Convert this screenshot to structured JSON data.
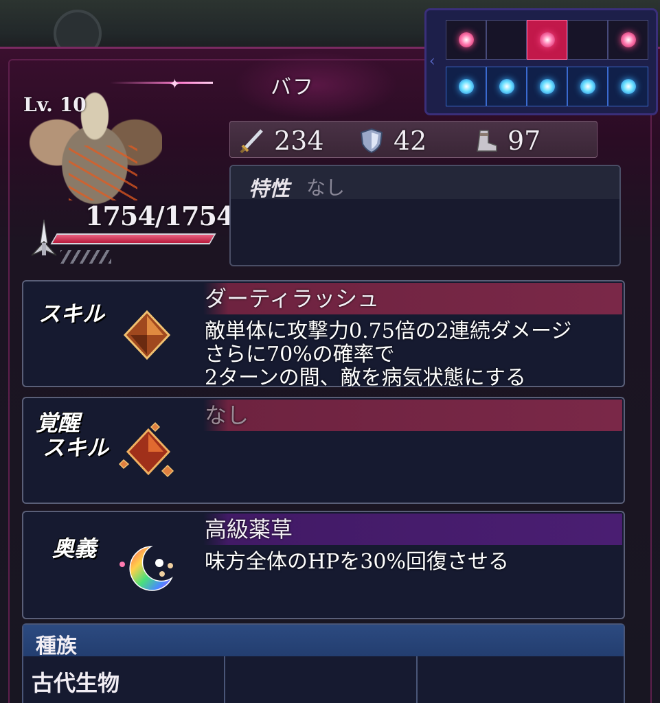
{
  "header": {
    "title": "バフ"
  },
  "formation": {
    "front_row": [
      true,
      false,
      true,
      false,
      true
    ],
    "front_row_active_slot": 2,
    "back_row": [
      true,
      true,
      true,
      true,
      true
    ],
    "colors": {
      "front": "#ff4a8a",
      "back": "#3ab0ff"
    }
  },
  "character": {
    "level_label": "Lv. 10",
    "hp_text": "1754/1754",
    "hp_fraction": 1.0,
    "class_icon": "sword-icon"
  },
  "stats": {
    "attack": "234",
    "defense": "42",
    "speed": "97"
  },
  "trait": {
    "label": "特性",
    "value": "なし"
  },
  "skill": {
    "label": "スキル",
    "name": "ダーティラッシュ",
    "desc_line1": "敵単体に攻撃力0.75倍の2連続ダメージ",
    "desc_line2": "さらに70%の確率で",
    "desc_line3": "2ターンの間、敵を病気状態にする"
  },
  "awaken_skill": {
    "label_line1": "覚醒",
    "label_line2": "スキル",
    "name": "なし"
  },
  "ougi": {
    "label": "奥義",
    "name": "高級薬草",
    "desc_line1": "味方全体のHPを30%回復させる"
  },
  "race": {
    "label": "種族",
    "value": "古代生物"
  }
}
